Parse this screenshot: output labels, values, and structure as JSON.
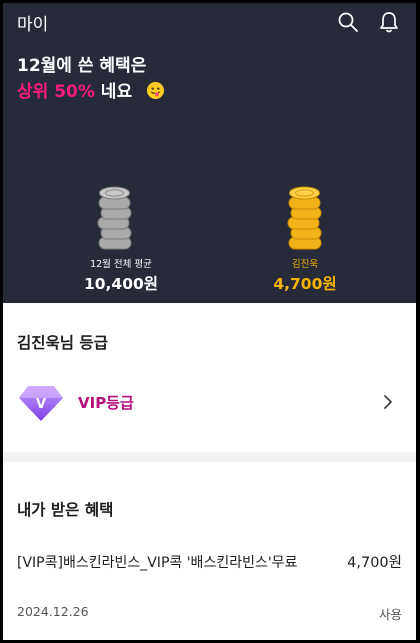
{
  "header": {
    "title": "마이",
    "icons": [
      "search-icon",
      "bell-icon"
    ]
  },
  "summary": {
    "line1": "12월에 쓴 혜택은",
    "highlight": "상위 50%",
    "line2_suffix": " 네요",
    "emoji": "smiling-face-with-tongue-icon",
    "average": {
      "label": "12월 전체 평균",
      "value": "10,400원"
    },
    "mine": {
      "label": "김진욱",
      "value": "4,700원"
    }
  },
  "grade": {
    "title": "김진욱님 등급",
    "badge_letter": "V",
    "label": "VIP등급"
  },
  "benefits": {
    "title": "내가 받은 혜택",
    "items": [
      {
        "name": "[VIP콕]배스킨라빈스_VIP콕 '배스킨라빈스'무료",
        "amount": "4,700원",
        "date": "2024.12.26",
        "status": "사용"
      }
    ]
  },
  "colors": {
    "dark_bg": "#272a39",
    "accent_pink": "#ff1b7f",
    "gold": "#f6b400",
    "vip_purple": "#b3107c"
  }
}
